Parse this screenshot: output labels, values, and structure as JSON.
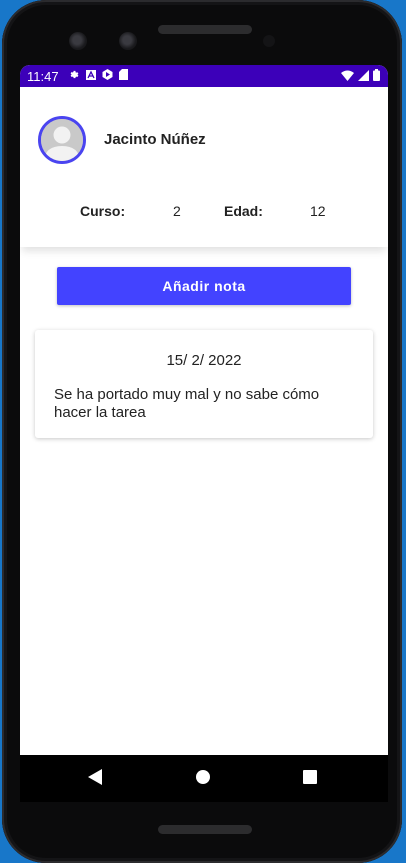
{
  "status_bar": {
    "time": "11:47",
    "left_icons": [
      "gear-icon",
      "font-icon",
      "play-icon",
      "sd-card-icon"
    ],
    "right_icons": [
      "wifi-icon",
      "signal-icon",
      "battery-icon"
    ],
    "color": "#3c00b9"
  },
  "student": {
    "name": "Jacinto Núñez",
    "course_label": "Curso:",
    "course_value": "2",
    "age_label": "Edad:",
    "age_value": "12"
  },
  "actions": {
    "add_note_label": "Añadir nota",
    "accent": "#4343ff"
  },
  "notes": [
    {
      "date": "15/ 2/ 2022",
      "text": "Se ha portado muy mal y no sabe cómo hacer la tarea"
    }
  ],
  "nav_bar": {
    "icons": [
      "back-icon",
      "home-icon",
      "recents-icon"
    ]
  }
}
